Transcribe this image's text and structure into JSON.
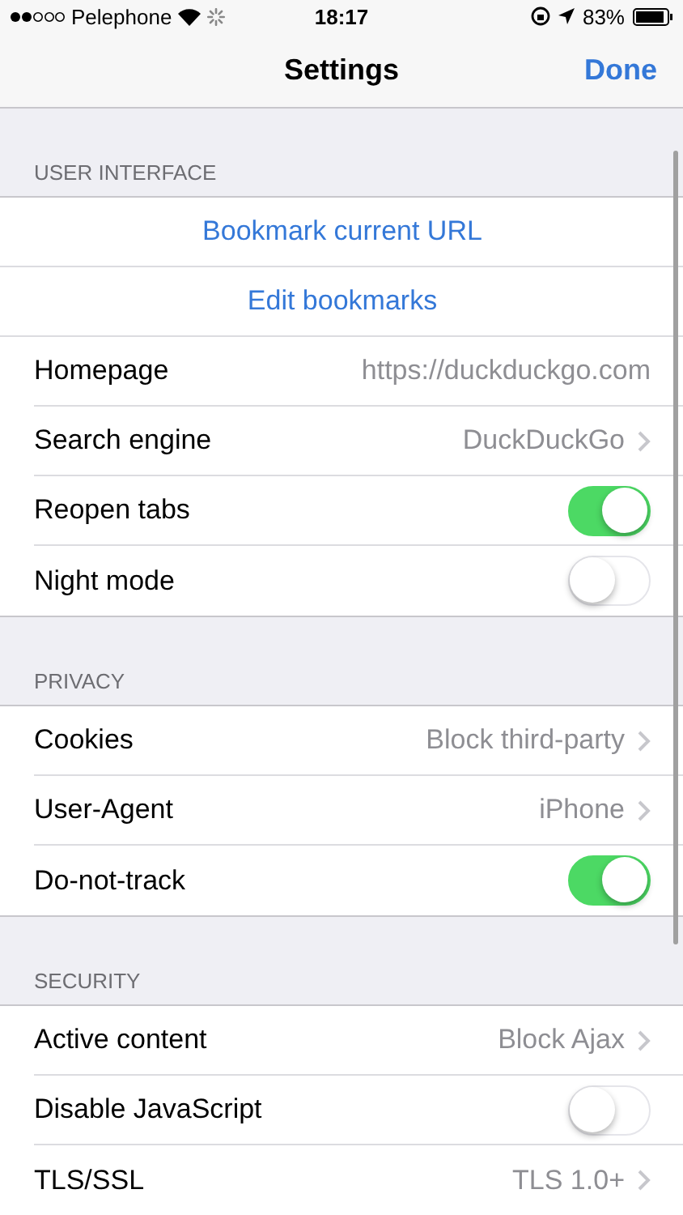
{
  "status_bar": {
    "carrier": "Pelephone",
    "time": "18:17",
    "battery": "83%"
  },
  "nav": {
    "title": "Settings",
    "done": "Done"
  },
  "sections": [
    {
      "header": "USER INTERFACE",
      "rows": [
        {
          "kind": "action",
          "label": "Bookmark current URL"
        },
        {
          "kind": "action",
          "label": "Edit bookmarks"
        },
        {
          "kind": "field",
          "label": "Homepage",
          "value": "https://duckduckgo.com"
        },
        {
          "kind": "disclosure",
          "label": "Search engine",
          "value": "DuckDuckGo"
        },
        {
          "kind": "toggle",
          "label": "Reopen tabs",
          "on": true
        },
        {
          "kind": "toggle",
          "label": "Night mode",
          "on": false
        }
      ]
    },
    {
      "header": "PRIVACY",
      "rows": [
        {
          "kind": "disclosure",
          "label": "Cookies",
          "value": "Block third-party"
        },
        {
          "kind": "disclosure",
          "label": "User-Agent",
          "value": "iPhone"
        },
        {
          "kind": "toggle",
          "label": "Do-not-track",
          "on": true
        }
      ]
    },
    {
      "header": "SECURITY",
      "rows": [
        {
          "kind": "disclosure",
          "label": "Active content",
          "value": "Block Ajax"
        },
        {
          "kind": "toggle",
          "label": "Disable JavaScript",
          "on": false
        },
        {
          "kind": "disclosure",
          "label": "TLS/SSL",
          "value": "TLS 1.0+"
        }
      ]
    }
  ]
}
